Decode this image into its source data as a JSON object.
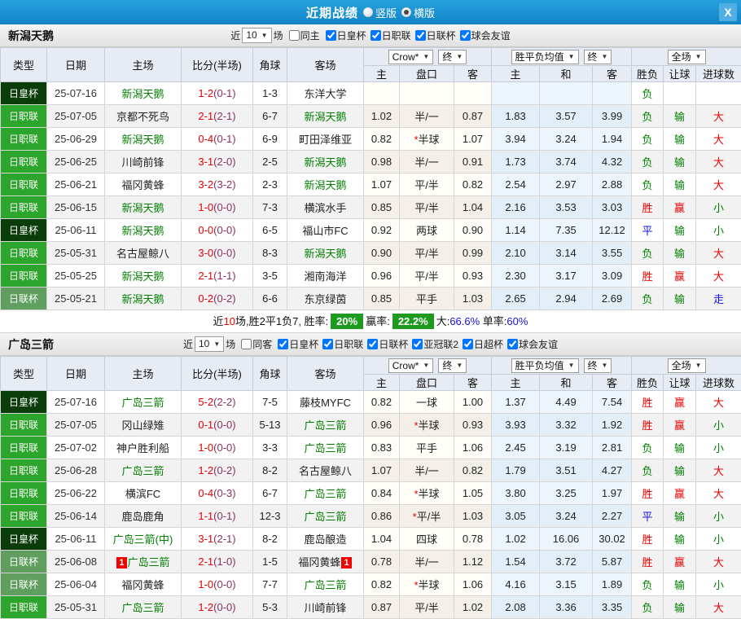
{
  "titlebar": {
    "title": "近期战绩",
    "options": [
      {
        "label": "竖版",
        "selected": false
      },
      {
        "label": "横版",
        "selected": true
      }
    ],
    "close_label": "X"
  },
  "colors": {
    "accent_blue": "#1a8fd1",
    "team_green": "#008000",
    "score_red": "#e60000",
    "half_score": "#8b3060",
    "badge": {
      "日皇杯": "#0b3d0b",
      "日职联": "#2ba52b",
      "日联杯": "#5f9e5f"
    },
    "result": {
      "胜": "#e60000",
      "平": "#1414dd",
      "负": "#008000",
      "赢": "#e60000",
      "输": "#008000",
      "走": "#1414dd",
      "大": "#e60000",
      "小": "#008000"
    },
    "summary_badge_green": "#1e9b1e"
  },
  "filter_labels": {
    "near": "近",
    "games": "场"
  },
  "table_header": {
    "left_cols": [
      "类型",
      "日期",
      "主场",
      "比分(半场)",
      "角球",
      "客场"
    ],
    "dropdown_group1": [
      "Crow*",
      "终"
    ],
    "dropdown_group2": [
      "胜平负均值",
      "终"
    ],
    "dropdown_group3": [
      "全场"
    ],
    "sub_cols": [
      "主",
      "盘口",
      "客",
      "主",
      "和",
      "客",
      "胜负",
      "让球",
      "进球数"
    ]
  },
  "sections": [
    {
      "team": "新潟天鹅",
      "filters": {
        "count": "10",
        "same_label": "同主",
        "same_checked": false,
        "leagues": [
          {
            "label": "日皇杯",
            "checked": true
          },
          {
            "label": "日职联",
            "checked": true
          },
          {
            "label": "日联杯",
            "checked": true
          },
          {
            "label": "球会友谊",
            "checked": true
          }
        ]
      },
      "rows": [
        {
          "type": "日皇杯",
          "date": "25-07-16",
          "home": "新潟天鹅",
          "home_hl": true,
          "home_badge": "",
          "score": "1-2",
          "half": "(0-1)",
          "corner": "1-3",
          "away": "东洋大学",
          "away_hl": false,
          "away_badge": "",
          "odds": [
            "",
            "",
            ""
          ],
          "avg": [
            "",
            "",
            ""
          ],
          "results": [
            "负",
            "",
            ""
          ]
        },
        {
          "type": "日职联",
          "date": "25-07-05",
          "home": "京都不死鸟",
          "home_hl": false,
          "home_badge": "",
          "score": "2-1",
          "half": "(2-1)",
          "corner": "6-7",
          "away": "新潟天鹅",
          "away_hl": true,
          "away_badge": "",
          "odds": [
            "1.02",
            "半/一",
            "0.87"
          ],
          "avg": [
            "1.83",
            "3.57",
            "3.99"
          ],
          "results": [
            "负",
            "输",
            "大"
          ]
        },
        {
          "type": "日职联",
          "date": "25-06-29",
          "home": "新潟天鹅",
          "home_hl": true,
          "home_badge": "",
          "score": "0-4",
          "half": "(0-1)",
          "corner": "6-9",
          "away": "町田泽维亚",
          "away_hl": false,
          "away_badge": "",
          "odds": [
            "0.82",
            "*半球",
            "1.07"
          ],
          "avg": [
            "3.94",
            "3.24",
            "1.94"
          ],
          "results": [
            "负",
            "输",
            "大"
          ]
        },
        {
          "type": "日职联",
          "date": "25-06-25",
          "home": "川崎前锋",
          "home_hl": false,
          "home_badge": "",
          "score": "3-1",
          "half": "(2-0)",
          "corner": "2-5",
          "away": "新潟天鹅",
          "away_hl": true,
          "away_badge": "",
          "odds": [
            "0.98",
            "半/一",
            "0.91"
          ],
          "avg": [
            "1.73",
            "3.74",
            "4.32"
          ],
          "results": [
            "负",
            "输",
            "大"
          ]
        },
        {
          "type": "日职联",
          "date": "25-06-21",
          "home": "福冈黄蜂",
          "home_hl": false,
          "home_badge": "",
          "score": "3-2",
          "half": "(3-2)",
          "corner": "2-3",
          "away": "新潟天鹅",
          "away_hl": true,
          "away_badge": "",
          "odds": [
            "1.07",
            "平/半",
            "0.82"
          ],
          "avg": [
            "2.54",
            "2.97",
            "2.88"
          ],
          "results": [
            "负",
            "输",
            "大"
          ]
        },
        {
          "type": "日职联",
          "date": "25-06-15",
          "home": "新潟天鹅",
          "home_hl": true,
          "home_badge": "",
          "score": "1-0",
          "half": "(0-0)",
          "corner": "7-3",
          "away": "横滨水手",
          "away_hl": false,
          "away_badge": "",
          "odds": [
            "0.85",
            "平/半",
            "1.04"
          ],
          "avg": [
            "2.16",
            "3.53",
            "3.03"
          ],
          "results": [
            "胜",
            "赢",
            "小"
          ]
        },
        {
          "type": "日皇杯",
          "date": "25-06-11",
          "home": "新潟天鹅",
          "home_hl": true,
          "home_badge": "",
          "score": "0-0",
          "half": "(0-0)",
          "corner": "6-5",
          "away": "福山市FC",
          "away_hl": false,
          "away_badge": "",
          "odds": [
            "0.92",
            "两球",
            "0.90"
          ],
          "avg": [
            "1.14",
            "7.35",
            "12.12"
          ],
          "results": [
            "平",
            "输",
            "小"
          ]
        },
        {
          "type": "日职联",
          "date": "25-05-31",
          "home": "名古屋鲸八",
          "home_hl": false,
          "home_badge": "",
          "score": "3-0",
          "half": "(0-0)",
          "corner": "8-3",
          "away": "新潟天鹅",
          "away_hl": true,
          "away_badge": "",
          "odds": [
            "0.90",
            "平/半",
            "0.99"
          ],
          "avg": [
            "2.10",
            "3.14",
            "3.55"
          ],
          "results": [
            "负",
            "输",
            "大"
          ]
        },
        {
          "type": "日职联",
          "date": "25-05-25",
          "home": "新潟天鹅",
          "home_hl": true,
          "home_badge": "",
          "score": "2-1",
          "half": "(1-1)",
          "corner": "3-5",
          "away": "湘南海洋",
          "away_hl": false,
          "away_badge": "",
          "odds": [
            "0.96",
            "平/半",
            "0.93"
          ],
          "avg": [
            "2.30",
            "3.17",
            "3.09"
          ],
          "results": [
            "胜",
            "赢",
            "大"
          ]
        },
        {
          "type": "日联杯",
          "date": "25-05-21",
          "home": "新潟天鹅",
          "home_hl": true,
          "home_badge": "",
          "score": "0-2",
          "half": "(0-2)",
          "corner": "6-6",
          "away": "东京绿茵",
          "away_hl": false,
          "away_badge": "",
          "odds": [
            "0.85",
            "平手",
            "1.03"
          ],
          "avg": [
            "2.65",
            "2.94",
            "2.69"
          ],
          "results": [
            "负",
            "输",
            "走"
          ]
        }
      ],
      "summary_segments": [
        {
          "t": "近",
          "s": "k"
        },
        {
          "t": "10",
          "s": "r"
        },
        {
          "t": "场,胜2平1负7, 胜率:",
          "s": "k"
        },
        {
          "t": "20%",
          "s": "g"
        },
        {
          "t": "赢率:",
          "s": "k"
        },
        {
          "t": "22.2%",
          "s": "g"
        },
        {
          "t": "大:",
          "s": "k"
        },
        {
          "t": "66.6%",
          "s": "b"
        },
        {
          "t": " 单率:",
          "s": "k"
        },
        {
          "t": "60%",
          "s": "b"
        }
      ]
    },
    {
      "team": "广岛三箭",
      "filters": {
        "count": "10",
        "same_label": "同客",
        "same_checked": false,
        "leagues": [
          {
            "label": "日皇杯",
            "checked": true
          },
          {
            "label": "日职联",
            "checked": true
          },
          {
            "label": "日联杯",
            "checked": true
          },
          {
            "label": "亚冠联2",
            "checked": true
          },
          {
            "label": "日超杯",
            "checked": true
          },
          {
            "label": "球会友谊",
            "checked": true
          }
        ]
      },
      "rows": [
        {
          "type": "日皇杯",
          "date": "25-07-16",
          "home": "广岛三箭",
          "home_hl": true,
          "home_badge": "",
          "score": "5-2",
          "half": "(2-2)",
          "corner": "7-5",
          "away": "藤枝MYFC",
          "away_hl": false,
          "away_badge": "",
          "odds": [
            "0.82",
            "一球",
            "1.00"
          ],
          "avg": [
            "1.37",
            "4.49",
            "7.54"
          ],
          "results": [
            "胜",
            "赢",
            "大"
          ]
        },
        {
          "type": "日职联",
          "date": "25-07-05",
          "home": "冈山绿雉",
          "home_hl": false,
          "home_badge": "",
          "score": "0-1",
          "half": "(0-0)",
          "corner": "5-13",
          "away": "广岛三箭",
          "away_hl": true,
          "away_badge": "",
          "odds": [
            "0.96",
            "*半球",
            "0.93"
          ],
          "avg": [
            "3.93",
            "3.32",
            "1.92"
          ],
          "results": [
            "胜",
            "赢",
            "小"
          ]
        },
        {
          "type": "日职联",
          "date": "25-07-02",
          "home": "神户胜利船",
          "home_hl": false,
          "home_badge": "",
          "score": "1-0",
          "half": "(0-0)",
          "corner": "3-3",
          "away": "广岛三箭",
          "away_hl": true,
          "away_badge": "",
          "odds": [
            "0.83",
            "平手",
            "1.06"
          ],
          "avg": [
            "2.45",
            "3.19",
            "2.81"
          ],
          "results": [
            "负",
            "输",
            "小"
          ]
        },
        {
          "type": "日职联",
          "date": "25-06-28",
          "home": "广岛三箭",
          "home_hl": true,
          "home_badge": "",
          "score": "1-2",
          "half": "(0-2)",
          "corner": "8-2",
          "away": "名古屋鲸八",
          "away_hl": false,
          "away_badge": "",
          "odds": [
            "1.07",
            "半/一",
            "0.82"
          ],
          "avg": [
            "1.79",
            "3.51",
            "4.27"
          ],
          "results": [
            "负",
            "输",
            "大"
          ]
        },
        {
          "type": "日职联",
          "date": "25-06-22",
          "home": "横滨FC",
          "home_hl": false,
          "home_badge": "",
          "score": "0-4",
          "half": "(0-3)",
          "corner": "6-7",
          "away": "广岛三箭",
          "away_hl": true,
          "away_badge": "",
          "odds": [
            "0.84",
            "*半球",
            "1.05"
          ],
          "avg": [
            "3.80",
            "3.25",
            "1.97"
          ],
          "results": [
            "胜",
            "赢",
            "大"
          ]
        },
        {
          "type": "日职联",
          "date": "25-06-14",
          "home": "鹿岛鹿角",
          "home_hl": false,
          "home_badge": "",
          "score": "1-1",
          "half": "(0-1)",
          "corner": "12-3",
          "away": "广岛三箭",
          "away_hl": true,
          "away_badge": "",
          "odds": [
            "0.86",
            "*平/半",
            "1.03"
          ],
          "avg": [
            "3.05",
            "3.24",
            "2.27"
          ],
          "results": [
            "平",
            "输",
            "小"
          ]
        },
        {
          "type": "日皇杯",
          "date": "25-06-11",
          "home": "广岛三箭(中)",
          "home_hl": true,
          "home_badge": "",
          "score": "3-1",
          "half": "(2-1)",
          "corner": "8-2",
          "away": "鹿岛酿造",
          "away_hl": false,
          "away_badge": "",
          "odds": [
            "1.04",
            "四球",
            "0.78"
          ],
          "avg": [
            "1.02",
            "16.06",
            "30.02"
          ],
          "results": [
            "胜",
            "输",
            "小"
          ]
        },
        {
          "type": "日联杯",
          "date": "25-06-08",
          "home": "广岛三箭",
          "home_hl": true,
          "home_badge": "1",
          "score": "2-1",
          "half": "(1-0)",
          "corner": "1-5",
          "away": "福冈黄蜂",
          "away_hl": false,
          "away_badge": "1",
          "odds": [
            "0.78",
            "半/一",
            "1.12"
          ],
          "avg": [
            "1.54",
            "3.72",
            "5.87"
          ],
          "results": [
            "胜",
            "赢",
            "大"
          ]
        },
        {
          "type": "日联杯",
          "date": "25-06-04",
          "home": "福冈黄蜂",
          "home_hl": false,
          "home_badge": "",
          "score": "1-0",
          "half": "(0-0)",
          "corner": "7-7",
          "away": "广岛三箭",
          "away_hl": true,
          "away_badge": "",
          "odds": [
            "0.82",
            "*半球",
            "1.06"
          ],
          "avg": [
            "4.16",
            "3.15",
            "1.89"
          ],
          "results": [
            "负",
            "输",
            "小"
          ]
        },
        {
          "type": "日职联",
          "date": "25-05-31",
          "home": "广岛三箭",
          "home_hl": true,
          "home_badge": "",
          "score": "1-2",
          "half": "(0-0)",
          "corner": "5-3",
          "away": "川崎前锋",
          "away_hl": false,
          "away_badge": "",
          "odds": [
            "0.87",
            "平/半",
            "1.02"
          ],
          "avg": [
            "2.08",
            "3.36",
            "3.35"
          ],
          "results": [
            "负",
            "输",
            "大"
          ]
        }
      ],
      "summary_segments": []
    }
  ]
}
